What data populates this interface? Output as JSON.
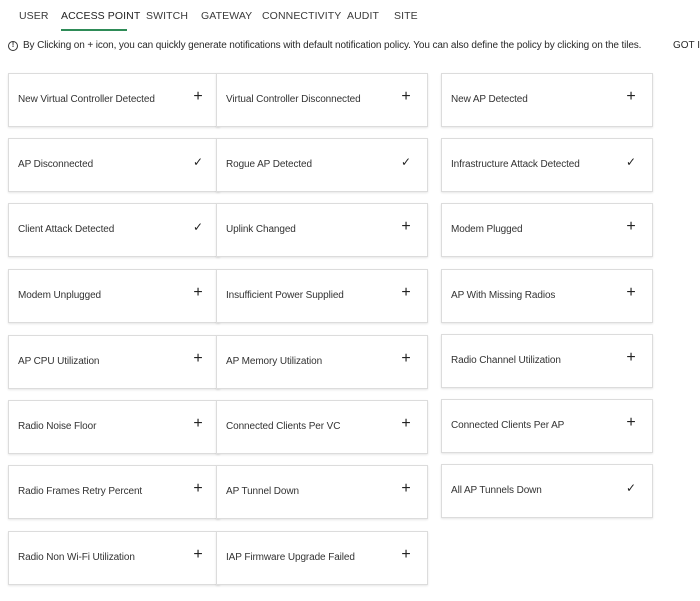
{
  "tabs": [
    {
      "label": "USER",
      "active": false
    },
    {
      "label": "ACCESS POINT",
      "active": true
    },
    {
      "label": "SWITCH",
      "active": false
    },
    {
      "label": "GATEWAY",
      "active": false
    },
    {
      "label": "CONNECTIVITY",
      "active": false
    },
    {
      "label": "AUDIT",
      "active": false
    },
    {
      "label": "SITE",
      "active": false
    }
  ],
  "info": {
    "icon": "info-circle-icon",
    "text": "By Clicking on + icon, you can quickly generate notifications with default notification policy. You can also define the policy by clicking on the tiles.",
    "got_it": "GOT IT"
  },
  "colors": {
    "accent": "#2e8b57"
  },
  "tiles": [
    {
      "label": "New Virtual Controller Detected",
      "icon": "plus-icon"
    },
    {
      "label": "Virtual Controller Disconnected",
      "icon": "plus-icon"
    },
    {
      "label": "New AP Detected",
      "icon": "plus-icon"
    },
    {
      "label": "AP Disconnected",
      "icon": "check-icon"
    },
    {
      "label": "Rogue AP Detected",
      "icon": "check-icon"
    },
    {
      "label": "Infrastructure Attack Detected",
      "icon": "check-icon"
    },
    {
      "label": "Client Attack Detected",
      "icon": "check-icon"
    },
    {
      "label": "Uplink Changed",
      "icon": "plus-icon"
    },
    {
      "label": "Modem Plugged",
      "icon": "plus-icon"
    },
    {
      "label": "Modem Unplugged",
      "icon": "plus-icon"
    },
    {
      "label": "Insufficient Power Supplied",
      "icon": "plus-icon"
    },
    {
      "label": "AP With Missing Radios",
      "icon": "plus-icon"
    },
    {
      "label": "AP CPU Utilization",
      "icon": "plus-icon"
    },
    {
      "label": "AP Memory Utilization",
      "icon": "plus-icon"
    },
    {
      "label": "Radio Channel Utilization",
      "icon": "plus-icon"
    },
    {
      "label": "Radio Noise Floor",
      "icon": "plus-icon"
    },
    {
      "label": "Connected Clients Per VC",
      "icon": "plus-icon"
    },
    {
      "label": "Connected Clients Per AP",
      "icon": "plus-icon"
    },
    {
      "label": "Radio Frames Retry Percent",
      "icon": "plus-icon"
    },
    {
      "label": "AP Tunnel Down",
      "icon": "plus-icon"
    },
    {
      "label": "All AP Tunnels Down",
      "icon": "check-icon"
    },
    {
      "label": "Radio Non Wi-Fi Utilization",
      "icon": "plus-icon"
    },
    {
      "label": "IAP Firmware Upgrade Failed",
      "icon": "plus-icon"
    }
  ]
}
